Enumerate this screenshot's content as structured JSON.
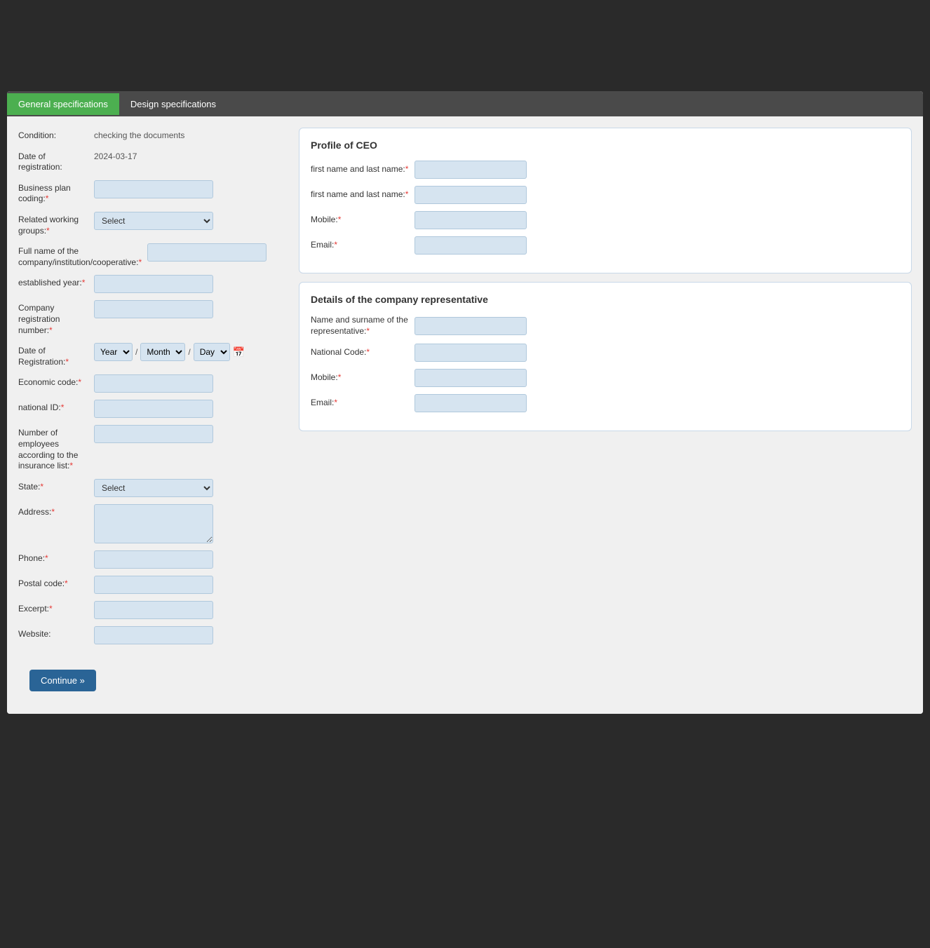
{
  "tabs": [
    {
      "id": "general",
      "label": "General specifications",
      "active": true
    },
    {
      "id": "design",
      "label": "Design specifications",
      "active": false
    }
  ],
  "left_form": {
    "condition": {
      "label": "Condition:",
      "required": false,
      "value": "checking the documents"
    },
    "date_of_registration": {
      "label": "Date of registration:",
      "required": false,
      "value": "2024-03-17"
    },
    "business_plan_coding": {
      "label": "Business plan coding:",
      "required_star": "*",
      "placeholder": ""
    },
    "related_working_groups": {
      "label": "Related working groups:",
      "required_star": "*",
      "select_default": "Select"
    },
    "full_name": {
      "label": "Full name of the company/institution/cooperative:",
      "required_star": "*"
    },
    "established_year": {
      "label": "established year:",
      "required_star": "*"
    },
    "company_registration_number": {
      "label": "Company registration number:",
      "required_star": "*"
    },
    "date_of_registration_field": {
      "label": "Date of Registration:",
      "required_star": "*",
      "year_default": "Year",
      "month_default": "Month",
      "day_default": "Day"
    },
    "economic_code": {
      "label": "Economic code:",
      "required_star": "*"
    },
    "national_id": {
      "label": "national ID:",
      "required_star": "*"
    },
    "number_of_employees": {
      "label": "Number of employees according to the insurance list:",
      "required_star": "*"
    },
    "state": {
      "label": "State:",
      "required_star": "*",
      "select_default": "Select"
    },
    "address": {
      "label": "Address:",
      "required_star": "*"
    },
    "phone": {
      "label": "Phone:",
      "required_star": "*"
    },
    "postal_code": {
      "label": "Postal code:",
      "required_star": "*"
    },
    "excerpt": {
      "label": "Excerpt:",
      "required_star": "*"
    },
    "website": {
      "label": "Website:",
      "required_star": ""
    }
  },
  "ceo_card": {
    "title": "Profile of CEO",
    "fields": [
      {
        "label": "first name and last name:",
        "required_star": "*",
        "id": "ceo-first-last-1"
      },
      {
        "label": "first name and last name:",
        "required_star": "*",
        "id": "ceo-first-last-2"
      },
      {
        "label": "Mobile:",
        "required_star": "*",
        "id": "ceo-mobile"
      },
      {
        "label": "Email:",
        "required_star": "*",
        "id": "ceo-email"
      }
    ]
  },
  "representative_card": {
    "title": "Details of the company representative",
    "fields": [
      {
        "label": "Name and surname of the representative:",
        "required_star": "*",
        "id": "rep-name"
      },
      {
        "label": "National Code:",
        "required_star": "*",
        "id": "rep-national-code"
      },
      {
        "label": "Mobile:",
        "required_star": "*",
        "id": "rep-mobile"
      },
      {
        "label": "Email:",
        "required_star": "*",
        "id": "rep-email"
      }
    ]
  },
  "continue_button": "Continue »"
}
